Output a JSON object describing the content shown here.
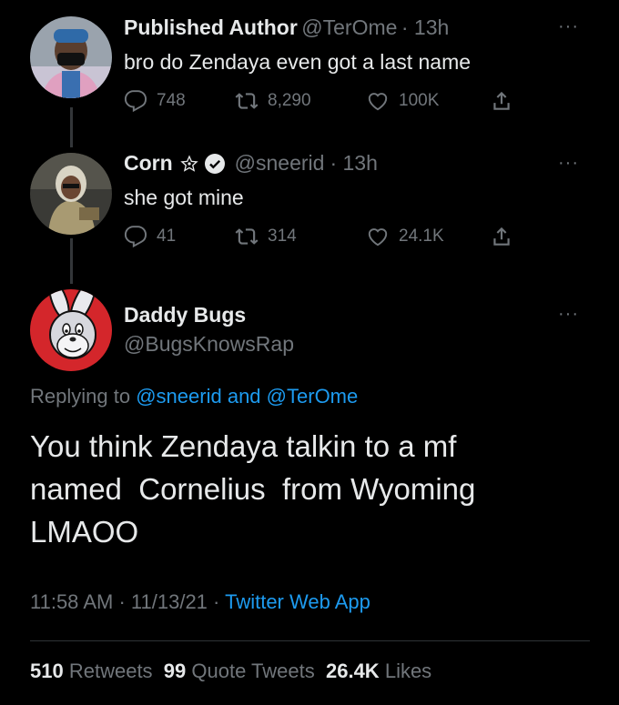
{
  "thread": [
    {
      "name": "Published Author",
      "handle": "@TerOme",
      "time": "· 13h",
      "text": "bro do Zendaya even got a last name",
      "replies": "748",
      "retweets": "8,290",
      "likes": "100K"
    },
    {
      "name": "Corn",
      "badge_icon": "star-icon",
      "verified_icon": "verified-badge-icon",
      "handle": "@sneerid",
      "time": "· 13h",
      "text": "she got mine",
      "replies": "41",
      "retweets": "314",
      "likes": "24.1K"
    }
  ],
  "main_tweet": {
    "name": "Daddy Bugs",
    "handle": "@BugsKnowsRap",
    "replying_label": "Replying to",
    "mention_1": "@sneerid",
    "and_label": "and",
    "mention_2": "@TerOme",
    "text_line_1": "You think Zendaya talkin to a mf",
    "text_line_2": "named  Cornelius  from Wyoming",
    "text_line_3": "LMAOO",
    "time": "11:58 AM",
    "date": "11/13/21",
    "app": "Twitter Web App",
    "retweets_count": "510",
    "retweets_label": "Retweets",
    "quotes_count": "99",
    "quotes_label": "Quote Tweets",
    "likes_count": "26.4K",
    "likes_label": "Likes"
  },
  "more_label": "···",
  "colors": {
    "background": "#000000",
    "text": "#e7e9ea",
    "muted": "#71767b",
    "accent": "#1d9bf0"
  }
}
